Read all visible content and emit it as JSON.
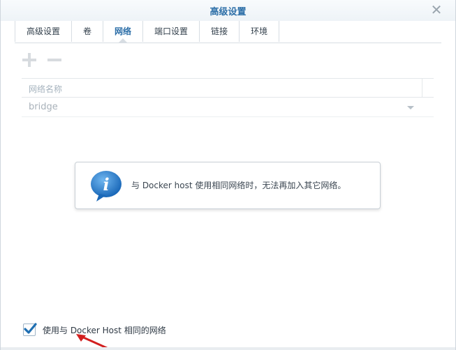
{
  "dialog": {
    "title": "高级设置",
    "close_icon": "close-icon"
  },
  "tabs": [
    {
      "label": "高级设置",
      "active": false
    },
    {
      "label": "卷",
      "active": false
    },
    {
      "label": "网络",
      "active": true
    },
    {
      "label": "端口设置",
      "active": false
    },
    {
      "label": "链接",
      "active": false
    },
    {
      "label": "环境",
      "active": false
    }
  ],
  "toolbar": {
    "add_icon": "plus-icon",
    "remove_icon": "minus-icon"
  },
  "grid": {
    "column_header": "网络名称",
    "rows": [
      {
        "name": "bridge"
      }
    ]
  },
  "info": {
    "icon": "info-bubble-icon",
    "message": "与 Docker host 使用相同网络时，无法再加入其它网络。"
  },
  "option": {
    "checked": true,
    "label": "使用与 Docker Host 相同的网络"
  },
  "colors": {
    "accent": "#2d6fa8",
    "info_blue": "#1f77c9",
    "checkbox_check": "#1f6fb2",
    "arrow_red": "#d21f1f"
  }
}
